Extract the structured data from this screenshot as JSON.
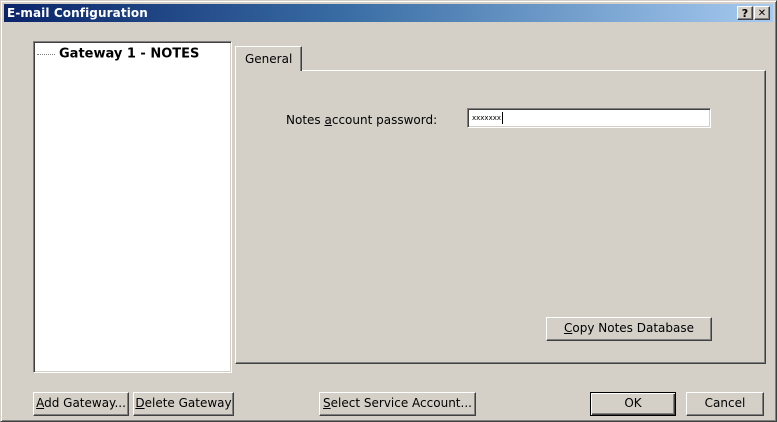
{
  "window": {
    "title": "E-mail Configuration",
    "help_button": "?",
    "close_button": "✕"
  },
  "tree": {
    "items": [
      {
        "label": "Gateway 1 - NOTES"
      }
    ]
  },
  "tabs": [
    {
      "label": "General",
      "selected": true
    }
  ],
  "general": {
    "password_label_pre": "Notes ",
    "password_label_key": "a",
    "password_label_post": "ccount password:",
    "password_value": "xxxxxxx",
    "copy_db_key": "C",
    "copy_db_rest": "opy Notes Database"
  },
  "footer": {
    "add_gateway_key": "A",
    "add_gateway_rest": "dd Gateway...",
    "delete_gateway_key": "D",
    "delete_gateway_rest": "elete Gateway",
    "select_service_key": "S",
    "select_service_rest": "elect Service Account...",
    "ok_label": "OK",
    "cancel_label": "Cancel"
  }
}
